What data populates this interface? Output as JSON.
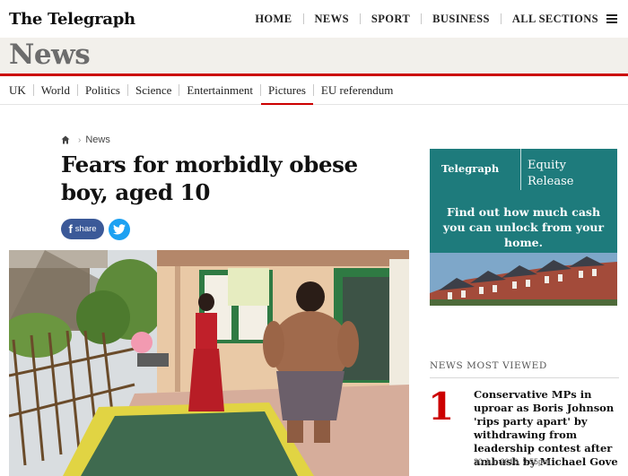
{
  "header": {
    "masthead": "The Telegraph",
    "nav": [
      {
        "label": "HOME"
      },
      {
        "label": "NEWS"
      },
      {
        "label": "SPORT"
      },
      {
        "label": "BUSINESS"
      },
      {
        "label": "ALL SECTIONS",
        "icon": "menu-icon"
      }
    ]
  },
  "section": {
    "title": "News",
    "subnav": [
      {
        "label": "UK"
      },
      {
        "label": "World"
      },
      {
        "label": "Politics"
      },
      {
        "label": "Science"
      },
      {
        "label": "Entertainment"
      },
      {
        "label": "Pictures",
        "active": true
      },
      {
        "label": "EU referendum"
      }
    ]
  },
  "article": {
    "breadcrumb": {
      "home_icon": "home-icon",
      "label": "News"
    },
    "headline": "Fears for morbidly obese boy, aged 10",
    "share": {
      "facebook_label": "share",
      "facebook_glyph": "f",
      "twitter_icon": "twitter-bird-icon"
    }
  },
  "advert": {
    "logo": "Telegraph",
    "product": [
      "Equity",
      "Release"
    ],
    "cta": "Find out how much cash you can unlock from your home."
  },
  "most_viewed": {
    "heading": "NEWS MOST VIEWED",
    "items": [
      {
        "rank": "1",
        "title": "Conservative MPs in uproar as Boris Johnson 'rips party apart' by withdrawing from leadership contest after ambush by Michael Gove",
        "date": "30 Jun 2016, 9:55pm"
      }
    ]
  },
  "colors": {
    "accent_red": "#cc0000",
    "section_band": "#f2f0eb",
    "advert_teal": "#1e7b7c",
    "facebook_blue": "#3b5998",
    "twitter_blue": "#1da1f2"
  }
}
